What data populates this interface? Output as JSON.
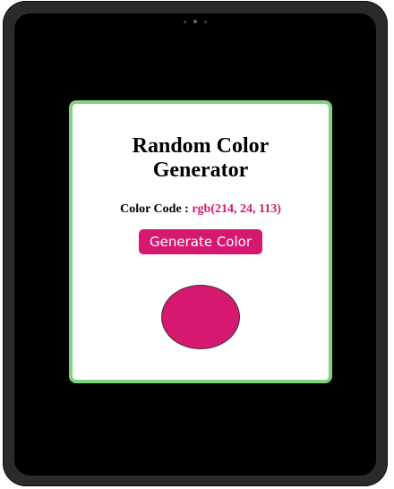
{
  "app": {
    "title": "Random Color Generator",
    "color_code_label": "Color Code : ",
    "color_code_value": "rgb(214, 24, 113)",
    "button_label": "Generate Color"
  },
  "colors": {
    "current": "#d61871",
    "card_border": "#7fd27f",
    "screen_background": "#000000"
  }
}
